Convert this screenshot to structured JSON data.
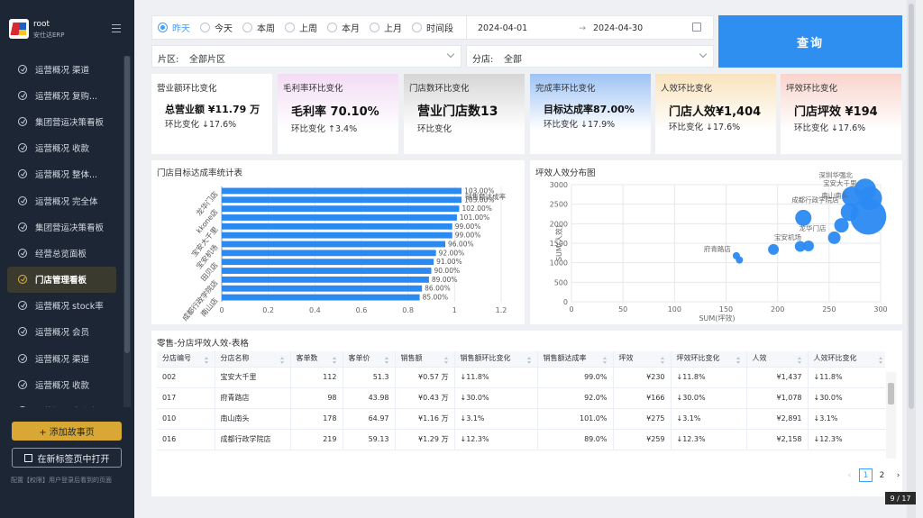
{
  "sidebar": {
    "user_name": "root",
    "user_org": "安仕达ERP",
    "items": [
      {
        "label": "运营概况 渠道",
        "active": false
      },
      {
        "label": "运营概况 复购...",
        "active": false
      },
      {
        "label": "集团营运决策看板",
        "active": false
      },
      {
        "label": "运营概况 收款",
        "active": false
      },
      {
        "label": "运营概况 整体...",
        "active": false
      },
      {
        "label": "运营概况 完全体",
        "active": false
      },
      {
        "label": "集团营运决策看板",
        "active": false
      },
      {
        "label": "经营总览面板",
        "active": false
      },
      {
        "label": "门店管理看板",
        "active": true
      },
      {
        "label": "运营概况 stock率",
        "active": false
      },
      {
        "label": "运营概况 会员",
        "active": false
      },
      {
        "label": "运营概况 渠道",
        "active": false
      },
      {
        "label": "运营概况 收款",
        "active": false
      },
      {
        "label": "运营概况 出库率",
        "active": false
      }
    ],
    "add_story_label": "+ 添加故事页",
    "open_newtab_label": "在新标签页中打开",
    "note": "配置【权限】用户登录后看到的页面"
  },
  "filters": {
    "periods": [
      "昨天",
      "今天",
      "本周",
      "上周",
      "本月",
      "上月",
      "时间段"
    ],
    "selected_period": "昨天",
    "date_start": "2024-04-01",
    "date_arrow": "→",
    "date_end": "2024-04-30",
    "area_label": "片区:",
    "area_value": "全部片区",
    "store_label": "分店:",
    "store_value": "全部",
    "query_label": "查询"
  },
  "cards": [
    {
      "title": "营业额环比变化",
      "value": "总营业额 ¥11.79 万",
      "sub": "环比变化 ↓17.6%",
      "bg": "#ffffff"
    },
    {
      "title": "毛利率环比变化",
      "value": "毛利率 70.10%",
      "sub": "环比变化 ↑3.4%",
      "bg": "#f3dcf5"
    },
    {
      "title": "门店数环比变化",
      "value": "营业门店数13",
      "sub": "环比变化",
      "bg": "#d6d6d6"
    },
    {
      "title": "完成率环比变化",
      "value": "目标达成率87.00%",
      "sub": "环比变化 ↓17.9%",
      "bg": "#9ec3f5"
    },
    {
      "title": "人效环比变化",
      "value": "门店人效¥1,404",
      "sub": "环比变化 ↓17.6%",
      "bg": "#f9e3bd"
    },
    {
      "title": "坪效环比变化",
      "value": "门店坪效 ¥194",
      "sub": "环比变化 ↓17.6%",
      "bg": "#f9d4cc"
    }
  ],
  "bar_chart": {
    "title": "门店目标达成率统计表",
    "legend": "销售额达成率",
    "categories": [
      "龙华门店",
      "",
      "kkone店",
      "",
      "宝安大千里",
      "",
      "宝安机场",
      "",
      "田贝店",
      "",
      "成都行政学院店",
      "",
      "南山店"
    ],
    "values": [
      1.03,
      1.03,
      1.02,
      1.01,
      0.99,
      0.99,
      0.96,
      0.92,
      0.91,
      0.9,
      0.89,
      0.86,
      0.85
    ],
    "value_labels": [
      "103.00%",
      "103.00%",
      "102.00%",
      "101.00%",
      "99.00%",
      "99.00%",
      "96.00%",
      "92.00%",
      "91.00%",
      "90.00%",
      "89.00%",
      "86.00%",
      "85.00%"
    ],
    "x_ticks": [
      "0",
      "0.2",
      "0.4",
      "0.6",
      "0.8",
      "1",
      "1.2"
    ],
    "xlim": [
      0,
      1.2
    ],
    "color": "#2b8af2"
  },
  "scatter_chart": {
    "title": "坪效人效分布图",
    "xlabel": "SUM(坪效)",
    "ylabel": "SUM(人效)",
    "x_ticks": [
      "0",
      "50",
      "100",
      "150",
      "200",
      "250",
      "300"
    ],
    "y_ticks": [
      "0",
      "500",
      "1000",
      "1500",
      "2000",
      "2500",
      "3000"
    ],
    "xlim": [
      0,
      300
    ],
    "ylim": [
      0,
      3000
    ],
    "color": "#2b8af2",
    "points": [
      {
        "x": 160,
        "y": 1180,
        "r": 4,
        "label": "府青路店"
      },
      {
        "x": 163,
        "y": 1070,
        "r": 4,
        "label": ""
      },
      {
        "x": 196,
        "y": 1340,
        "r": 6,
        "label": ""
      },
      {
        "x": 222,
        "y": 1420,
        "r": 6,
        "label": ""
      },
      {
        "x": 230,
        "y": 1430,
        "r": 6,
        "label": "宝安机场"
      },
      {
        "x": 225,
        "y": 2150,
        "r": 9,
        "label": ""
      },
      {
        "x": 255,
        "y": 1640,
        "r": 7,
        "label": "龙华门店"
      },
      {
        "x": 262,
        "y": 1960,
        "r": 8,
        "label": ""
      },
      {
        "x": 270,
        "y": 2300,
        "r": 10,
        "label": "成都行政学院店"
      },
      {
        "x": 272,
        "y": 2700,
        "r": 11,
        "label": ""
      },
      {
        "x": 288,
        "y": 2180,
        "r": 20,
        "label": "南山南头"
      },
      {
        "x": 285,
        "y": 2880,
        "r": 12,
        "label": "深圳华强北"
      },
      {
        "x": 290,
        "y": 2650,
        "r": 13,
        "label": "宝安大千里"
      }
    ]
  },
  "table": {
    "title": "零售-分店坪效人效-表格",
    "headers": [
      "分店编号",
      "分店名称",
      "客单数",
      "客单价",
      "销售额",
      "销售额环比变化",
      "销售额达成率",
      "坪效",
      "坪效环比变化",
      "人效",
      "人效环比变化"
    ],
    "rows": [
      [
        "002",
        "宝安大千里",
        "112",
        "51.3",
        "¥0.57 万",
        "↓11.8%",
        "99.0%",
        "¥230",
        "↓11.8%",
        "¥1,437",
        "↓11.8%"
      ],
      [
        "017",
        "府青路店",
        "98",
        "43.98",
        "¥0.43 万",
        "↓30.0%",
        "92.0%",
        "¥166",
        "↓30.0%",
        "¥1,078",
        "↓30.0%"
      ],
      [
        "010",
        "南山南头",
        "178",
        "64.97",
        "¥1.16 万",
        "↓3.1%",
        "101.0%",
        "¥275",
        "↓3.1%",
        "¥2,891",
        "↓3.1%"
      ],
      [
        "016",
        "成都行政学院店",
        "219",
        "59.13",
        "¥1.29 万",
        "↓12.3%",
        "89.0%",
        "¥259",
        "↓12.3%",
        "¥2,158",
        "↓12.3%"
      ]
    ],
    "pages": [
      "1",
      "2"
    ],
    "current_page": "1",
    "page_counter": "9 / 17"
  }
}
